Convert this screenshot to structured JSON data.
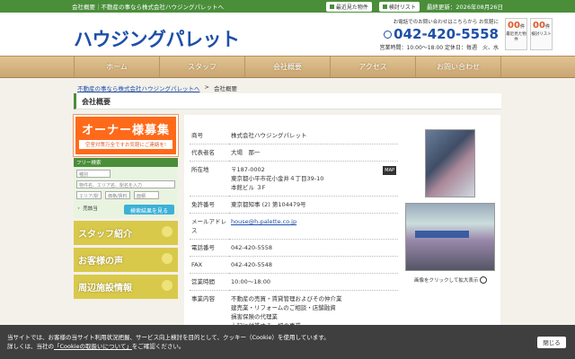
{
  "topbar": {
    "left": "会社概要｜不動産の事なら株式会社ハウジングパレットへ",
    "recent": "最近見た物件",
    "consider": "検討リスト",
    "updated": "最終更新：2026年08月26日"
  },
  "header": {
    "logo": "ハウジングパレット",
    "contact_line": "お電話でのお問い合わせはこちらから お気軽に",
    "phone": "042-420-5558",
    "hours": "営業時間：10:00〜18:00 定休日：毎週　火、水",
    "recent_count": "00",
    "recent_unit": "件",
    "recent_label": "最近見た物件",
    "consider_count": "00",
    "consider_unit": "件",
    "consider_label": "検討リスト"
  },
  "nav": [
    "ホーム",
    "スタッフ",
    "会社概要",
    "アクセス",
    "お問い合わせ"
  ],
  "breadcrumb": {
    "home": "不動産の事なら株式会社ハウジングパレットへ",
    "sep": ">",
    "current": "会社概要"
  },
  "page_title": "会社概要",
  "sidebar": {
    "owner_title": "オーナー様募集",
    "owner_sub": "空室対策万全ですお気軽にご連絡を!",
    "free_search": "フリー検索",
    "type_placeholder": "種別",
    "keyword_placeholder": "物件名、エリア名、駅名を入力",
    "area_placeholder": "エリア/駅",
    "price_placeholder": "価格/賃料",
    "size_placeholder": "面積",
    "sold_check": "・ 売該当",
    "search_button": "検索結果を見る",
    "banners": [
      "スタッフ紹介",
      "お客様の声",
      "周辺施設情報"
    ]
  },
  "company": [
    {
      "k": "商号",
      "v": "株式会社ハウジングパレット"
    },
    {
      "k": "代表者名",
      "v": "大場　那一"
    },
    {
      "k": "所在地",
      "v": "〒187-0002\n東京都小平市花小金井４丁目39-10\n本館ビル ３F",
      "map": "MAP"
    },
    {
      "k": "免許番号",
      "v": "東京都知事 (2) 第104479号"
    },
    {
      "k": "メールアドレス",
      "v": "house@h-palette.co.jp"
    },
    {
      "k": "電話番号",
      "v": "042-420-5558"
    },
    {
      "k": "FAX",
      "v": "042-420-5548"
    },
    {
      "k": "営業時間",
      "v": "10:00〜18:00"
    },
    {
      "k": "事業内容",
      "v": "不動産の売買・賃貸管理およびその仲介業\n建売業・リフォームのご相談・店舗融資\n損害保険の代理業\n上記に付帯する一切の事業"
    }
  ],
  "photo_caption": "画像をクリックして拡大表示",
  "cookie": {
    "line1": "当サイトでは、お客様の当サイト利用状況把握、サービス向上検討を目的として、クッキー（Cookie）を使用しています。",
    "line2a": "詳しくは、当社の",
    "link": "「Cookieの取扱いについて」",
    "line2b": "をご確認ください。",
    "close": "閉じる"
  }
}
